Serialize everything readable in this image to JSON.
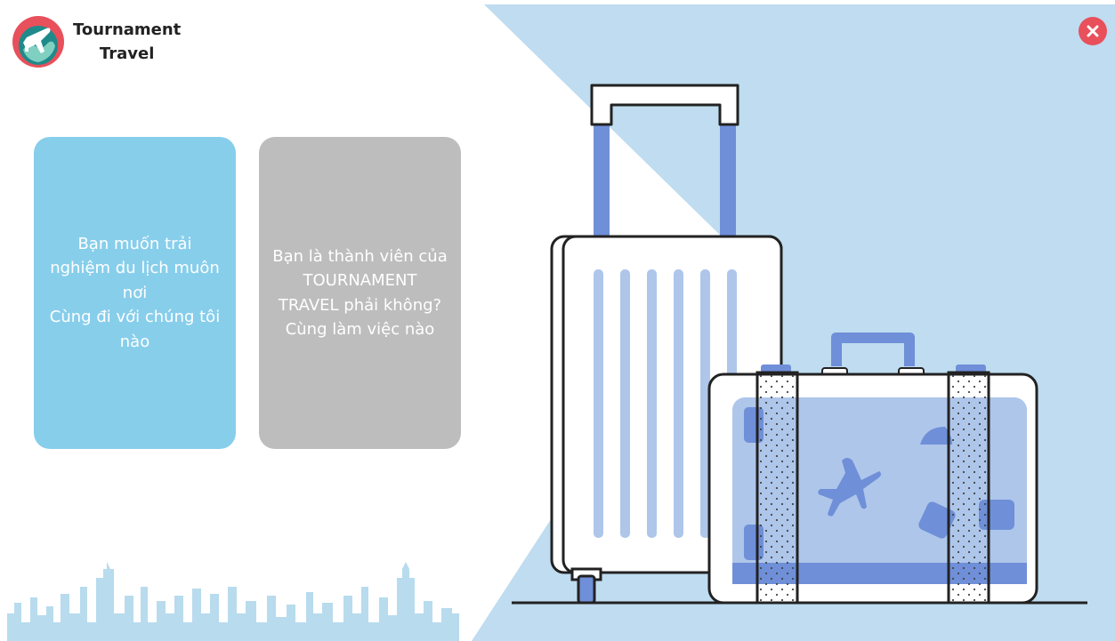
{
  "brand": {
    "title_line1": "Tournament",
    "title_line2": "Travel",
    "logo_icon": "globe-airplane-icon"
  },
  "close_button": {
    "icon": "close-icon",
    "color": "#e8505b"
  },
  "cards": [
    {
      "id": "traveler",
      "lines": [
        "Bạn muốn trải",
        "nghiệm du lịch muôn",
        "nơi",
        "Cùng đi với chúng tôi",
        "nào"
      ],
      "background": "#87ceeb"
    },
    {
      "id": "member",
      "lines": [
        "Bạn là thành viên của",
        "TOURNAMENT",
        "TRAVEL phải không?",
        "Cùng làm việc nào"
      ],
      "background": "#bdbdbd"
    }
  ],
  "illustration": {
    "name": "luggage-illustration",
    "colors": {
      "background": "#bfdcf0",
      "accent_blue": "#6f8fd8",
      "light_blue": "#aec6ea",
      "skyline": "#b8dbee"
    }
  }
}
